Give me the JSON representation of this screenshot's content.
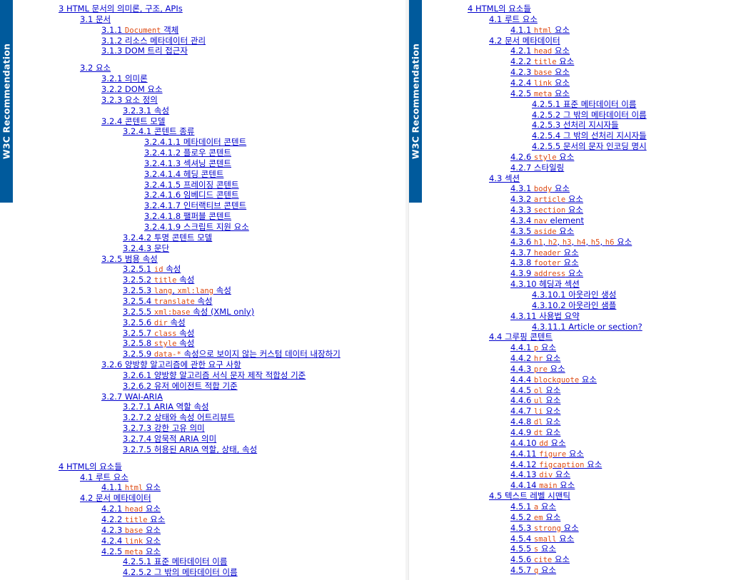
{
  "badge_text": "W3C Recommendation",
  "colors": {
    "link": "#0000cc",
    "code": "#dd4a14",
    "badge": "#005a9c"
  },
  "left_toc": [
    {
      "level": 0,
      "parts": [
        {
          "t": "3 HTML 문서의 의미론, 구조, APIs"
        }
      ]
    },
    {
      "level": 1,
      "parts": [
        {
          "t": "3.1 문서"
        }
      ]
    },
    {
      "level": 2,
      "parts": [
        {
          "t": "3.1.1 "
        },
        {
          "t": "Document",
          "c": true
        },
        {
          "t": " 객체"
        }
      ]
    },
    {
      "level": 2,
      "parts": [
        {
          "t": "3.1.2 리소스 메타데이터 관리"
        }
      ]
    },
    {
      "level": 2,
      "parts": [
        {
          "t": "3.1.3 DOM 트리 접근자"
        }
      ]
    },
    {
      "level": 1,
      "gap": true,
      "parts": [
        {
          "t": "3.2 요소"
        }
      ]
    },
    {
      "level": 2,
      "parts": [
        {
          "t": "3.2.1 의미론"
        }
      ]
    },
    {
      "level": 2,
      "parts": [
        {
          "t": "3.2.2 DOM 요소"
        }
      ]
    },
    {
      "level": 2,
      "parts": [
        {
          "t": "3.2.3 요소 정의"
        }
      ]
    },
    {
      "level": 3,
      "parts": [
        {
          "t": "3.2.3.1 속성"
        }
      ]
    },
    {
      "level": 2,
      "parts": [
        {
          "t": "3.2.4 콘텐트 모델"
        }
      ]
    },
    {
      "level": 3,
      "parts": [
        {
          "t": "3.2.4.1 콘텐트 종류"
        }
      ]
    },
    {
      "level": 4,
      "parts": [
        {
          "t": "3.2.4.1.1 메타데이터 콘텐트"
        }
      ]
    },
    {
      "level": 4,
      "parts": [
        {
          "t": "3.2.4.1.2 플로우 콘텐트"
        }
      ]
    },
    {
      "level": 4,
      "parts": [
        {
          "t": "3.2.4.1.3 섹셔닝 콘텐트"
        }
      ]
    },
    {
      "level": 4,
      "parts": [
        {
          "t": "3.2.4.1.4 헤딩 콘텐트"
        }
      ]
    },
    {
      "level": 4,
      "parts": [
        {
          "t": "3.2.4.1.5 프레이징 콘텐트"
        }
      ]
    },
    {
      "level": 4,
      "parts": [
        {
          "t": "3.2.4.1.6 임베디드 콘텐트"
        }
      ]
    },
    {
      "level": 4,
      "parts": [
        {
          "t": "3.2.4.1.7 인터랙티브 콘텐트"
        }
      ]
    },
    {
      "level": 4,
      "parts": [
        {
          "t": "3.2.4.1.8 팰퍼블 콘텐트"
        }
      ]
    },
    {
      "level": 4,
      "parts": [
        {
          "t": "3.2.4.1.9 스크립트 지원 요소"
        }
      ]
    },
    {
      "level": 3,
      "parts": [
        {
          "t": "3.2.4.2 투명 콘텐트 모델"
        }
      ]
    },
    {
      "level": 3,
      "parts": [
        {
          "t": "3.2.4.3 문단"
        }
      ]
    },
    {
      "level": 2,
      "parts": [
        {
          "t": "3.2.5 범용 속성"
        }
      ]
    },
    {
      "level": 3,
      "parts": [
        {
          "t": "3.2.5.1 "
        },
        {
          "t": "id",
          "c": true
        },
        {
          "t": " 속성"
        }
      ]
    },
    {
      "level": 3,
      "parts": [
        {
          "t": "3.2.5.2 "
        },
        {
          "t": "title",
          "c": true
        },
        {
          "t": " 속성"
        }
      ]
    },
    {
      "level": 3,
      "parts": [
        {
          "t": "3.2.5.3 "
        },
        {
          "t": "lang",
          "c": true
        },
        {
          "t": ", "
        },
        {
          "t": "xml:lang",
          "c": true
        },
        {
          "t": " 속성"
        }
      ]
    },
    {
      "level": 3,
      "parts": [
        {
          "t": "3.2.5.4 "
        },
        {
          "t": "translate",
          "c": true
        },
        {
          "t": " 속성"
        }
      ]
    },
    {
      "level": 3,
      "parts": [
        {
          "t": "3.2.5.5 "
        },
        {
          "t": "xml:base",
          "c": true
        },
        {
          "t": " 속성 (XML only)"
        }
      ]
    },
    {
      "level": 3,
      "parts": [
        {
          "t": "3.2.5.6 "
        },
        {
          "t": "dir",
          "c": true
        },
        {
          "t": " 속성"
        }
      ]
    },
    {
      "level": 3,
      "parts": [
        {
          "t": "3.2.5.7 "
        },
        {
          "t": "class",
          "c": true
        },
        {
          "t": " 속성"
        }
      ]
    },
    {
      "level": 3,
      "parts": [
        {
          "t": "3.2.5.8 "
        },
        {
          "t": "style",
          "c": true
        },
        {
          "t": " 속성"
        }
      ]
    },
    {
      "level": 3,
      "parts": [
        {
          "t": "3.2.5.9 "
        },
        {
          "t": "data-*",
          "c": true
        },
        {
          "t": " 속성으로 보이지 않는 커스텀 데이터 내장하기"
        }
      ]
    },
    {
      "level": 2,
      "parts": [
        {
          "t": "3.2.6 양방향 알고리즘에 관한 요구 사항"
        }
      ]
    },
    {
      "level": 3,
      "parts": [
        {
          "t": "3.2.6.1 양방향 알고리즘 서식 문자 제작 적합성 기준"
        }
      ]
    },
    {
      "level": 3,
      "parts": [
        {
          "t": "3.2.6.2 유저 에이전트 적합 기준"
        }
      ]
    },
    {
      "level": 2,
      "parts": [
        {
          "t": "3.2.7 WAI-ARIA"
        }
      ]
    },
    {
      "level": 3,
      "parts": [
        {
          "t": "3.2.7.1 ARIA 역할 속성"
        }
      ]
    },
    {
      "level": 3,
      "parts": [
        {
          "t": "3.2.7.2 상태와 속성 어트리뷰트"
        }
      ]
    },
    {
      "level": 3,
      "parts": [
        {
          "t": "3.2.7.3 강한 고유 의미"
        }
      ]
    },
    {
      "level": 3,
      "parts": [
        {
          "t": "3.2.7.4 암묵적 ARIA 의미"
        }
      ]
    },
    {
      "level": 3,
      "parts": [
        {
          "t": "3.2.7.5 허용된 ARIA 역할, 상태, 속성"
        }
      ]
    },
    {
      "level": 0,
      "gap": true,
      "parts": [
        {
          "t": "4 HTML의 요소들"
        }
      ]
    },
    {
      "level": 1,
      "parts": [
        {
          "t": "4.1 루트 요소"
        }
      ]
    },
    {
      "level": 2,
      "parts": [
        {
          "t": "4.1.1 "
        },
        {
          "t": "html",
          "c": true
        },
        {
          "t": " 요소"
        }
      ]
    },
    {
      "level": 1,
      "parts": [
        {
          "t": "4.2 문서 메타데이터"
        }
      ]
    },
    {
      "level": 2,
      "parts": [
        {
          "t": "4.2.1 "
        },
        {
          "t": "head",
          "c": true
        },
        {
          "t": " 요소"
        }
      ]
    },
    {
      "level": 2,
      "parts": [
        {
          "t": "4.2.2 "
        },
        {
          "t": "title",
          "c": true
        },
        {
          "t": " 요소"
        }
      ]
    },
    {
      "level": 2,
      "parts": [
        {
          "t": "4.2.3 "
        },
        {
          "t": "base",
          "c": true
        },
        {
          "t": " 요소"
        }
      ]
    },
    {
      "level": 2,
      "parts": [
        {
          "t": "4.2.4 "
        },
        {
          "t": "link",
          "c": true
        },
        {
          "t": " 요소"
        }
      ]
    },
    {
      "level": 2,
      "parts": [
        {
          "t": "4.2.5 "
        },
        {
          "t": "meta",
          "c": true
        },
        {
          "t": " 요소"
        }
      ]
    },
    {
      "level": 3,
      "parts": [
        {
          "t": "4.2.5.1 표준 메타데이터 이름"
        }
      ]
    },
    {
      "level": 3,
      "parts": [
        {
          "t": "4.2.5.2 그 밖의 메타데이터 이름"
        }
      ]
    }
  ],
  "right_toc": [
    {
      "level": 0,
      "parts": [
        {
          "t": "4 HTML의 요소들"
        }
      ]
    },
    {
      "level": 1,
      "parts": [
        {
          "t": "4.1 루트 요소"
        }
      ]
    },
    {
      "level": 2,
      "parts": [
        {
          "t": "4.1.1 "
        },
        {
          "t": "html",
          "c": true
        },
        {
          "t": " 요소"
        }
      ]
    },
    {
      "level": 1,
      "parts": [
        {
          "t": "4.2 문서 메타데이터"
        }
      ]
    },
    {
      "level": 2,
      "parts": [
        {
          "t": "4.2.1 "
        },
        {
          "t": "head",
          "c": true
        },
        {
          "t": " 요소"
        }
      ]
    },
    {
      "level": 2,
      "parts": [
        {
          "t": "4.2.2 "
        },
        {
          "t": "title",
          "c": true
        },
        {
          "t": " 요소"
        }
      ]
    },
    {
      "level": 2,
      "parts": [
        {
          "t": "4.2.3 "
        },
        {
          "t": "base",
          "c": true
        },
        {
          "t": " 요소"
        }
      ]
    },
    {
      "level": 2,
      "parts": [
        {
          "t": "4.2.4 "
        },
        {
          "t": "link",
          "c": true
        },
        {
          "t": " 요소"
        }
      ]
    },
    {
      "level": 2,
      "parts": [
        {
          "t": "4.2.5 "
        },
        {
          "t": "meta",
          "c": true
        },
        {
          "t": " 요소"
        }
      ]
    },
    {
      "level": 3,
      "parts": [
        {
          "t": "4.2.5.1 표준 메타데이터 이름"
        }
      ]
    },
    {
      "level": 3,
      "parts": [
        {
          "t": "4.2.5.2 그 밖의 메타데이터 이름"
        }
      ]
    },
    {
      "level": 3,
      "parts": [
        {
          "t": "4.2.5.3 선처리 지시자들"
        }
      ]
    },
    {
      "level": 3,
      "parts": [
        {
          "t": "4.2.5.4 그 밖의 선처리 지시자들"
        }
      ]
    },
    {
      "level": 3,
      "parts": [
        {
          "t": "4.2.5.5 문서의 문자 인코딩 명시"
        }
      ]
    },
    {
      "level": 2,
      "parts": [
        {
          "t": "4.2.6 "
        },
        {
          "t": "style",
          "c": true
        },
        {
          "t": " 요소"
        }
      ]
    },
    {
      "level": 2,
      "parts": [
        {
          "t": "4.2.7 스타일링"
        }
      ]
    },
    {
      "level": 1,
      "parts": [
        {
          "t": "4.3 섹션"
        }
      ]
    },
    {
      "level": 2,
      "parts": [
        {
          "t": "4.3.1 "
        },
        {
          "t": "body",
          "c": true
        },
        {
          "t": " 요소"
        }
      ]
    },
    {
      "level": 2,
      "parts": [
        {
          "t": "4.3.2 "
        },
        {
          "t": "article",
          "c": true
        },
        {
          "t": " 요소"
        }
      ]
    },
    {
      "level": 2,
      "parts": [
        {
          "t": "4.3.3 "
        },
        {
          "t": "section",
          "c": true
        },
        {
          "t": " 요소"
        }
      ]
    },
    {
      "level": 2,
      "parts": [
        {
          "t": "4.3.4 "
        },
        {
          "t": "nav",
          "c": true
        },
        {
          "t": " element"
        }
      ]
    },
    {
      "level": 2,
      "parts": [
        {
          "t": "4.3.5 "
        },
        {
          "t": "aside",
          "c": true
        },
        {
          "t": " 요소"
        }
      ]
    },
    {
      "level": 2,
      "parts": [
        {
          "t": "4.3.6 "
        },
        {
          "t": "h1",
          "c": true
        },
        {
          "t": ", "
        },
        {
          "t": "h2",
          "c": true
        },
        {
          "t": ", "
        },
        {
          "t": "h3",
          "c": true
        },
        {
          "t": ", "
        },
        {
          "t": "h4",
          "c": true
        },
        {
          "t": ", "
        },
        {
          "t": "h5",
          "c": true
        },
        {
          "t": ", "
        },
        {
          "t": "h6",
          "c": true
        },
        {
          "t": " 요소"
        }
      ]
    },
    {
      "level": 2,
      "parts": [
        {
          "t": "4.3.7 "
        },
        {
          "t": "header",
          "c": true
        },
        {
          "t": " 요소"
        }
      ]
    },
    {
      "level": 2,
      "parts": [
        {
          "t": "4.3.8 "
        },
        {
          "t": "footer",
          "c": true
        },
        {
          "t": " 요소"
        }
      ]
    },
    {
      "level": 2,
      "parts": [
        {
          "t": "4.3.9 "
        },
        {
          "t": "address",
          "c": true
        },
        {
          "t": " 요소"
        }
      ]
    },
    {
      "level": 2,
      "parts": [
        {
          "t": "4.3.10 헤딩과 섹션"
        }
      ]
    },
    {
      "level": 3,
      "parts": [
        {
          "t": "4.3.10.1 아웃라인 생성"
        }
      ]
    },
    {
      "level": 3,
      "parts": [
        {
          "t": "4.3.10.2 아웃라인 샘플"
        }
      ]
    },
    {
      "level": 2,
      "parts": [
        {
          "t": "4.3.11 사용법 요약"
        }
      ]
    },
    {
      "level": 3,
      "parts": [
        {
          "t": "4.3.11.1 Article or section?"
        }
      ]
    },
    {
      "level": 1,
      "parts": [
        {
          "t": "4.4 그루핑 콘텐트"
        }
      ]
    },
    {
      "level": 2,
      "parts": [
        {
          "t": "4.4.1 "
        },
        {
          "t": "p",
          "c": true
        },
        {
          "t": " 요소"
        }
      ]
    },
    {
      "level": 2,
      "parts": [
        {
          "t": "4.4.2 "
        },
        {
          "t": "hr",
          "c": true
        },
        {
          "t": " 요소"
        }
      ]
    },
    {
      "level": 2,
      "parts": [
        {
          "t": "4.4.3 "
        },
        {
          "t": "pre",
          "c": true
        },
        {
          "t": " 요소"
        }
      ]
    },
    {
      "level": 2,
      "parts": [
        {
          "t": "4.4.4 "
        },
        {
          "t": "blockquote",
          "c": true
        },
        {
          "t": " 요소"
        }
      ]
    },
    {
      "level": 2,
      "parts": [
        {
          "t": "4.4.5 "
        },
        {
          "t": "ol",
          "c": true
        },
        {
          "t": " 요소"
        }
      ]
    },
    {
      "level": 2,
      "parts": [
        {
          "t": "4.4.6 "
        },
        {
          "t": "ul",
          "c": true
        },
        {
          "t": " 요소"
        }
      ]
    },
    {
      "level": 2,
      "parts": [
        {
          "t": "4.4.7 "
        },
        {
          "t": "li",
          "c": true
        },
        {
          "t": " 요소"
        }
      ]
    },
    {
      "level": 2,
      "parts": [
        {
          "t": "4.4.8 "
        },
        {
          "t": "dl",
          "c": true
        },
        {
          "t": " 요소"
        }
      ]
    },
    {
      "level": 2,
      "parts": [
        {
          "t": "4.4.9 "
        },
        {
          "t": "dt",
          "c": true
        },
        {
          "t": " 요소"
        }
      ]
    },
    {
      "level": 2,
      "parts": [
        {
          "t": "4.4.10 "
        },
        {
          "t": "dd",
          "c": true
        },
        {
          "t": " 요소"
        }
      ]
    },
    {
      "level": 2,
      "parts": [
        {
          "t": "4.4.11 "
        },
        {
          "t": "figure",
          "c": true
        },
        {
          "t": " 요소"
        }
      ]
    },
    {
      "level": 2,
      "parts": [
        {
          "t": "4.4.12 "
        },
        {
          "t": "figcaption",
          "c": true
        },
        {
          "t": " 요소"
        }
      ]
    },
    {
      "level": 2,
      "parts": [
        {
          "t": "4.4.13 "
        },
        {
          "t": "div",
          "c": true
        },
        {
          "t": " 요소"
        }
      ]
    },
    {
      "level": 2,
      "parts": [
        {
          "t": "4.4.14 "
        },
        {
          "t": "main",
          "c": true
        },
        {
          "t": " 요소"
        }
      ]
    },
    {
      "level": 1,
      "parts": [
        {
          "t": "4.5 텍스트 레벨 시맨틱"
        }
      ]
    },
    {
      "level": 2,
      "parts": [
        {
          "t": "4.5.1 "
        },
        {
          "t": "a",
          "c": true
        },
        {
          "t": " 요소"
        }
      ]
    },
    {
      "level": 2,
      "parts": [
        {
          "t": "4.5.2 "
        },
        {
          "t": "em",
          "c": true
        },
        {
          "t": " 요소"
        }
      ]
    },
    {
      "level": 2,
      "parts": [
        {
          "t": "4.5.3 "
        },
        {
          "t": "strong",
          "c": true
        },
        {
          "t": " 요소"
        }
      ]
    },
    {
      "level": 2,
      "parts": [
        {
          "t": "4.5.4 "
        },
        {
          "t": "small",
          "c": true
        },
        {
          "t": " 요소"
        }
      ]
    },
    {
      "level": 2,
      "parts": [
        {
          "t": "4.5.5 "
        },
        {
          "t": "s",
          "c": true
        },
        {
          "t": " 요소"
        }
      ]
    },
    {
      "level": 2,
      "parts": [
        {
          "t": "4.5.6 "
        },
        {
          "t": "cite",
          "c": true
        },
        {
          "t": " 요소"
        }
      ]
    },
    {
      "level": 2,
      "parts": [
        {
          "t": "4.5.7 "
        },
        {
          "t": "q",
          "c": true
        },
        {
          "t": " 요소"
        }
      ]
    }
  ]
}
